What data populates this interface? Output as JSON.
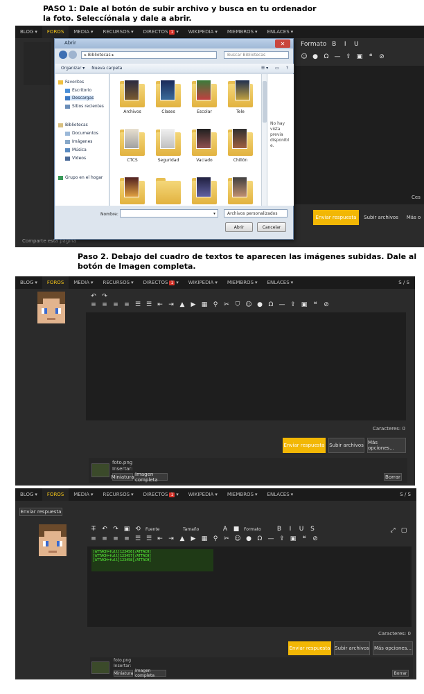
{
  "step1": {
    "caption_line1": "PASO 1: Dale al botón de subir archivo y busca en tu ordenador",
    "caption_line2": "la foto. Seleccíónala y dale a abrir."
  },
  "step2": {
    "caption_line1": "Paso 2. Debajo del cuadro de textos te aparecen las imágenes subidas. Dale al",
    "caption_line2": "botón de Imagen completa."
  },
  "nav": {
    "blog": "BLOG",
    "foros": "FOROS",
    "media": "MEDIA",
    "recursos": "RECURSOS",
    "directos": "DIRECTOS",
    "directos_badge": "1",
    "wikipedia": "WIKIPEDIA",
    "miembros": "MIEMBROS",
    "enlaces": "ENLACES",
    "account_short": "S / S"
  },
  "panel1": {
    "share_text": "Comparte esta página",
    "enviar": "Enviar respuesta",
    "subir": "Subir archivos",
    "mas": "Más o",
    "side_right": "Ces",
    "toolbar_format": "Formato"
  },
  "dialog": {
    "title": "Abrir",
    "address": "▸ Bibliotecas ▸",
    "search_placeholder": "Buscar Bibliotecas",
    "organize": "Organizar ▾",
    "new_folder": "Nueva carpeta",
    "nav_items": [
      "Favoritos",
      "Escritorio",
      "Descargas",
      "Sitios recientes",
      "Bibliotecas",
      "Documentos",
      "Imágenes",
      "Música",
      "Vídeos",
      "Grupo en el hogar"
    ],
    "folders": [
      "Archivos",
      "Clases",
      "Escolar",
      "Tele",
      "CTCS",
      "Seguridad",
      "Vaciado",
      "Chillón",
      "",
      "",
      "",
      ""
    ],
    "preview_note": "No hay vista previa disponible.",
    "filename_label": "Nombre:",
    "filetype": "Archivos personalizados",
    "open_btn": "Abrir",
    "cancel_btn": "Cancelar"
  },
  "panel2": {
    "chars": "Caracteres: 0",
    "enviar": "Enviar respuesta",
    "subir": "Subir archivos",
    "mas": "Más opciones...",
    "file_name": "foto.png",
    "file_sub": "Insertar:",
    "miniatura": "Miniatura",
    "imagen_completa": "Imagen completa",
    "borrar": "Borrar"
  },
  "panel3": {
    "tab_label": "Enviar respuesta",
    "font_name": "Fuente",
    "font_size": "Tamaño",
    "format": "Formato",
    "chars": "Caracteres: 0",
    "enviar": "Enviar respuesta",
    "subir": "Subir archivos",
    "mas": "Más opciones...",
    "file_name": "foto.png",
    "file_sub": "Insertar:",
    "miniatura": "Miniatura",
    "imagen_completa": "Imagen completa",
    "borrar": "Borrar",
    "code_lines": [
      "[ATTACH=full]123456[/ATTACH]",
      "[ATTACH=full]123457[/ATTACH]",
      "[ATTACH=full]123458[/ATTACH]"
    ]
  },
  "colors": {
    "accent": "#f2b705",
    "nav_bg": "#1b1b1b",
    "panel_bg": "#2b2b2b",
    "editor_bg": "#1e1e1e"
  }
}
